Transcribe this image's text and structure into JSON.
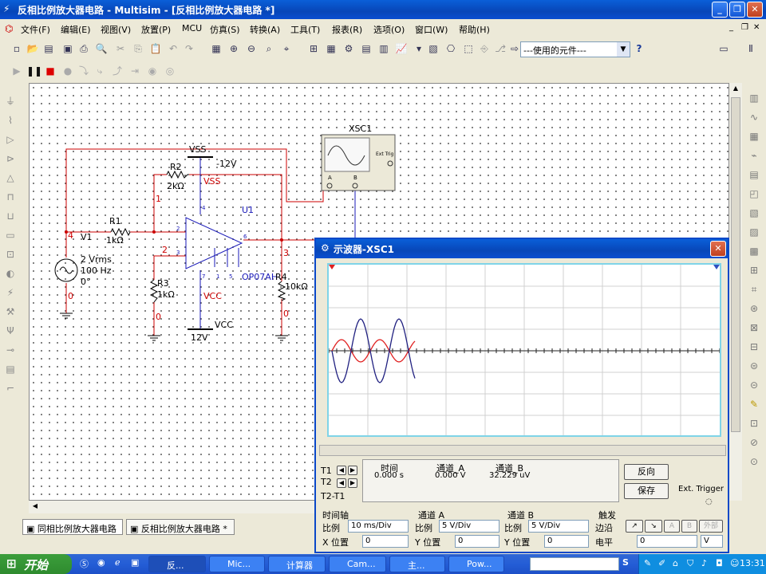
{
  "window": {
    "title": "反相比例放大器电路 - Multisim - [反相比例放大器电路 *]"
  },
  "menu": [
    {
      "label": "文件(F)"
    },
    {
      "label": "编辑(E)"
    },
    {
      "label": "视图(V)"
    },
    {
      "label": "放置(P)"
    },
    {
      "label": "MCU"
    },
    {
      "label": "仿真(S)"
    },
    {
      "label": "转换(A)"
    },
    {
      "label": "工具(T)"
    },
    {
      "label": "报表(R)"
    },
    {
      "label": "选项(O)"
    },
    {
      "label": "窗口(W)"
    },
    {
      "label": "帮助(H)"
    }
  ],
  "toolbar": {
    "in_use_list": "---使用的元件---"
  },
  "circuit": {
    "vss_label": "VSS",
    "vss_value": "-12V",
    "vss_supply": "VSS",
    "r2_name": "R2",
    "r2_value": "2kΩ",
    "r1_name": "R1",
    "r1_value": "1kΩ",
    "r3_name": "R3",
    "r3_value": "1kΩ",
    "r4_name": "R4",
    "r4_value": "10kΩ",
    "v1_name": "V1",
    "v1_amp": "2 Vrms",
    "v1_freq": "100 Hz",
    "v1_phase": "0°",
    "u1_name": "U1",
    "u1_model": "OP07AH",
    "vcc_supply": "VCC",
    "vcc_label": "VCC",
    "vcc_value": "12V",
    "xsc_name": "XSC1",
    "ext_trig": "Ext Trig",
    "node_1": "1",
    "node_2": "2",
    "node_3": "3",
    "node_4": "4",
    "node_0a": "0",
    "node_0b": "0",
    "node_0c": "0",
    "pin_a": "A",
    "pin_b": "B",
    "pin_4": "4",
    "pin_5": "5",
    "pin_1": "1",
    "pin_7": "7",
    "pin_3": "3",
    "pin_2": "2",
    "pin_6": "6"
  },
  "tabs": [
    {
      "label": "同相比例放大器电路"
    },
    {
      "label": "反相比例放大器电路 *"
    }
  ],
  "scope": {
    "title": "示波器-XSC1",
    "t1": "T1",
    "t2": "T2",
    "t2t1": "T2-T1",
    "col_time": "时间",
    "col_a": "通道_A",
    "col_b": "通道_B",
    "val_time": "0.000 s",
    "val_a": "0.000 V",
    "val_b": "32.229 uV",
    "reverse": "反向",
    "save": "保存",
    "ext_trigger": "Ext. Trigger",
    "timebase": {
      "title": "时间轴",
      "scale_label": "比例",
      "scale": "10 ms/Div",
      "pos_label": "X 位置",
      "pos": "0"
    },
    "chan_a": {
      "title": "通道 A",
      "scale_label": "比例",
      "scale": "5  V/Div",
      "pos_label": "Y 位置",
      "pos": "0"
    },
    "chan_b": {
      "title": "通道 B",
      "scale_label": "比例",
      "scale": "5  V/Div",
      "pos_label": "Y 位置",
      "pos": "0"
    },
    "trigger": {
      "title": "触发",
      "edge_label": "边沿",
      "level_label": "电平",
      "level": "0",
      "unit": "V",
      "a": "A",
      "b": "B",
      "ext": "外部"
    }
  },
  "taskbar": {
    "start": "开始",
    "tasks": [
      {
        "label": "反..."
      },
      {
        "label": "Mic..."
      },
      {
        "label": "计算器"
      },
      {
        "label": "Cam..."
      },
      {
        "label": "主..."
      },
      {
        "label": "Pow..."
      }
    ],
    "clock": "13:31"
  },
  "colors": {
    "red_wire": "#cc0000",
    "blue_wire": "#1a1ab8",
    "trace_a": "#e02020",
    "trace_b": "#202080"
  }
}
